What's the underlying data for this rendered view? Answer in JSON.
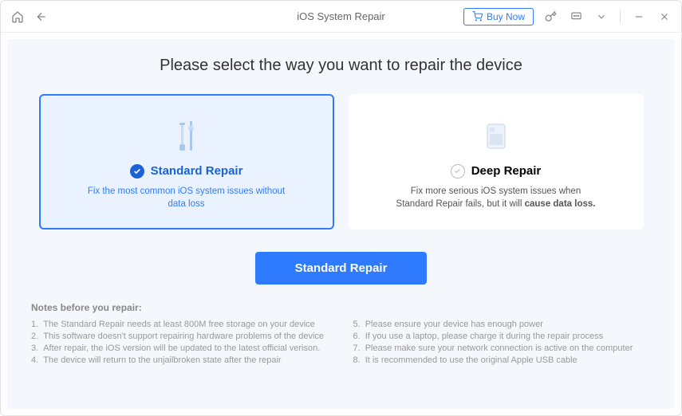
{
  "titlebar": {
    "title": "iOS System Repair",
    "buy_now": "Buy Now"
  },
  "page": {
    "heading": "Please select the way you want to repair the device"
  },
  "cards": {
    "standard": {
      "title": "Standard Repair",
      "desc": "Fix the most common iOS system issues without data loss"
    },
    "deep": {
      "title": "Deep Repair",
      "desc_prefix": "Fix more serious iOS system issues when Standard Repair fails, but it will ",
      "desc_bold": "cause data loss."
    }
  },
  "action": {
    "primary": "Standard Repair"
  },
  "notes": {
    "title": "Notes before you repair:",
    "items": [
      {
        "num": "1.",
        "text": "The Standard Repair needs at least 800M free storage on your device"
      },
      {
        "num": "2.",
        "text": "This software doesn't support repairing hardware problems of the device"
      },
      {
        "num": "3.",
        "text": "After repair, the iOS version will be updated to the latest official verison."
      },
      {
        "num": "4.",
        "text": "The device will return to the unjailbroken state after the repair"
      },
      {
        "num": "5.",
        "text": "Please ensure your device has enough power"
      },
      {
        "num": "6.",
        "text": "If you use a laptop, please charge it during the repair process"
      },
      {
        "num": "7.",
        "text": "Please make sure your network connection is active on the computer"
      },
      {
        "num": "8.",
        "text": "It is recommended to use the original Apple USB cable"
      }
    ]
  }
}
